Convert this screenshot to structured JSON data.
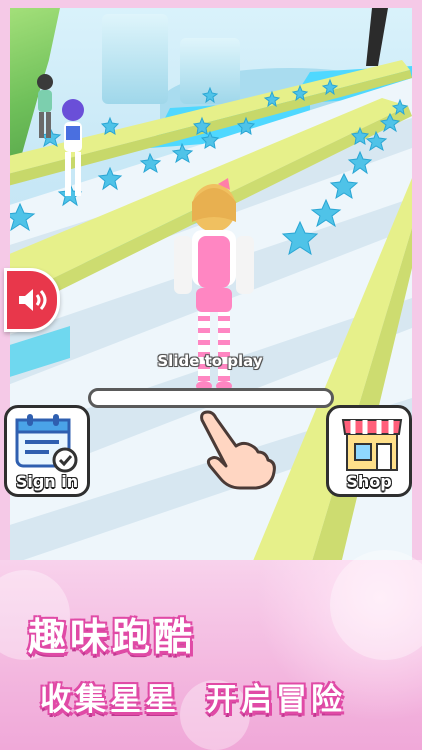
{
  "hud": {
    "slide_label": "Slide to play",
    "signin_label": "Sign in",
    "shop_label": "Shop"
  },
  "icons": {
    "sound": "speaker-icon",
    "signin": "calendar-check-icon",
    "shop": "store-awning-icon",
    "hand": "pointing-hand-icon"
  },
  "banner": {
    "title_line1": "趣味跑酷",
    "title_line2a": "收集星星",
    "title_line2b": "开启冒险"
  },
  "colors": {
    "accent_pink": "#e04aa6",
    "sound_red": "#e8374b",
    "rail_yellow": "#e6f08a",
    "star_blue": "#4fc3e8"
  }
}
